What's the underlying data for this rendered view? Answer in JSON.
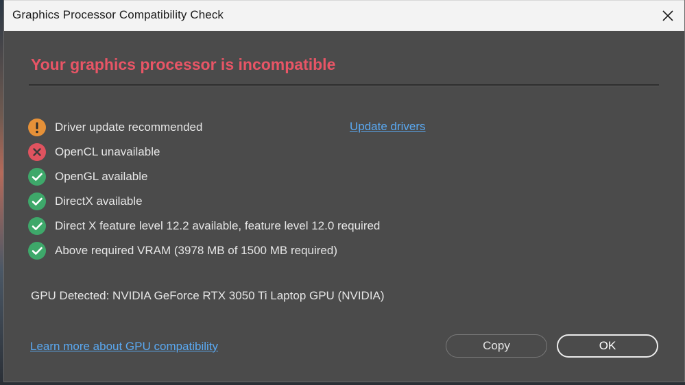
{
  "window": {
    "title": "Graphics Processor Compatibility Check"
  },
  "headline": "Your graphics processor is incompatible",
  "checks": [
    {
      "status": "warning",
      "icon": "warning-icon",
      "label": "Driver update recommended"
    },
    {
      "status": "error",
      "icon": "error-icon",
      "label": "OpenCL unavailable"
    },
    {
      "status": "ok",
      "icon": "check-icon",
      "label": "OpenGL available"
    },
    {
      "status": "ok",
      "icon": "check-icon",
      "label": "DirectX available"
    },
    {
      "status": "ok",
      "icon": "check-icon",
      "label": "Direct X feature level 12.2 available, feature level 12.0 required"
    },
    {
      "status": "ok",
      "icon": "check-icon",
      "label": "Above required VRAM (3978 MB of 1500 MB required)"
    }
  ],
  "update_link": "Update drivers",
  "gpu_detected": "GPU Detected: NVIDIA GeForce RTX 3050 Ti Laptop GPU (NVIDIA)",
  "learn_more_link": "Learn more about GPU compatibility",
  "buttons": {
    "copy": "Copy",
    "ok": "OK"
  },
  "colors": {
    "headline": "#e85566",
    "warning": "#e69138",
    "error": "#e0535f",
    "ok": "#3ea86a",
    "link": "#5aa9f2",
    "dialog_bg": "#4b4b4b"
  }
}
